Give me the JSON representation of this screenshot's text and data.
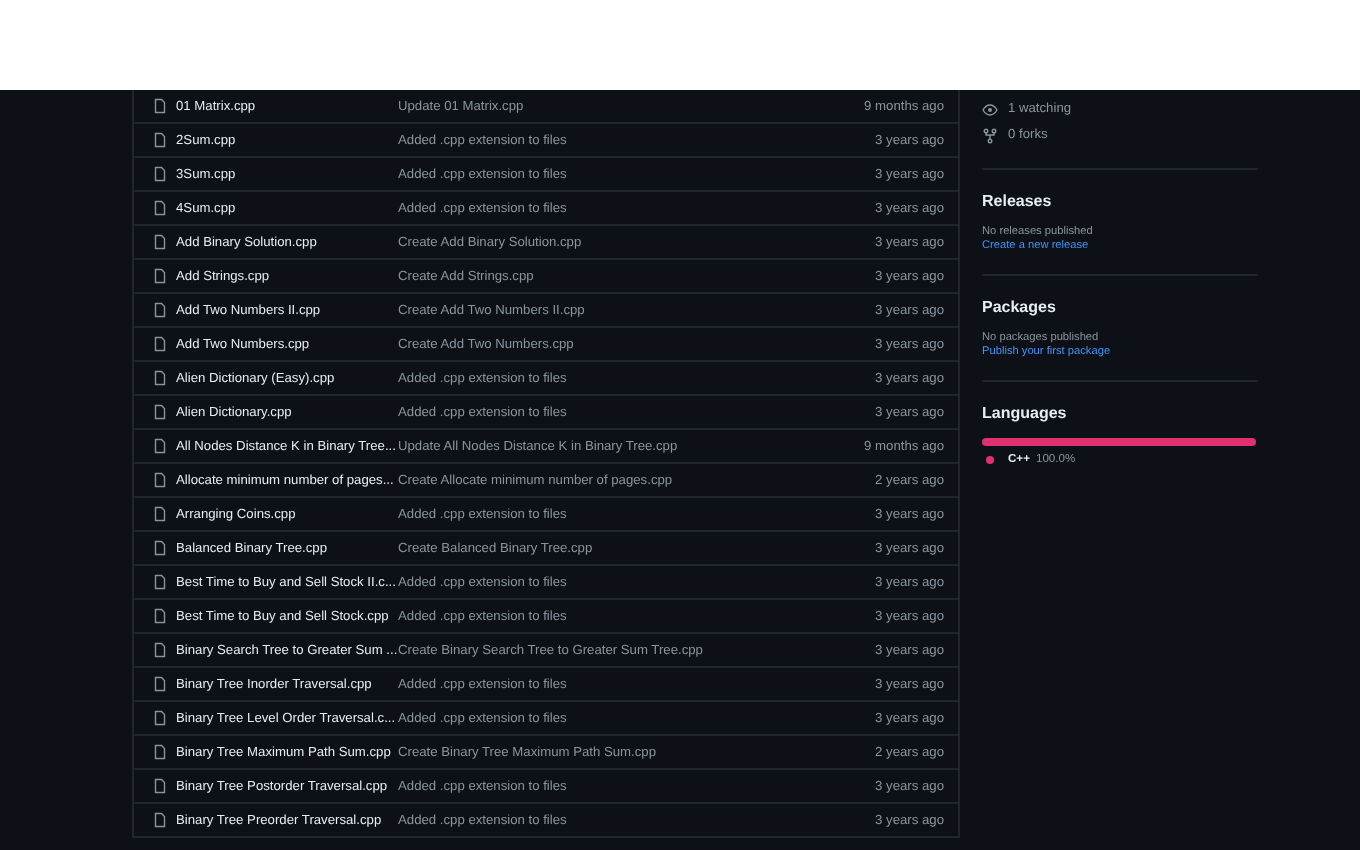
{
  "files": [
    {
      "name": "01 Matrix.cpp",
      "message": "Update 01 Matrix.cpp",
      "age": "9 months ago"
    },
    {
      "name": "2Sum.cpp",
      "message": "Added .cpp extension to files",
      "age": "3 years ago"
    },
    {
      "name": "3Sum.cpp",
      "message": "Added .cpp extension to files",
      "age": "3 years ago"
    },
    {
      "name": "4Sum.cpp",
      "message": "Added .cpp extension to files",
      "age": "3 years ago"
    },
    {
      "name": "Add Binary Solution.cpp",
      "message": "Create Add Binary Solution.cpp",
      "age": "3 years ago"
    },
    {
      "name": "Add Strings.cpp",
      "message": "Create Add Strings.cpp",
      "age": "3 years ago"
    },
    {
      "name": "Add Two Numbers II.cpp",
      "message": "Create Add Two Numbers II.cpp",
      "age": "3 years ago"
    },
    {
      "name": "Add Two Numbers.cpp",
      "message": "Create Add Two Numbers.cpp",
      "age": "3 years ago"
    },
    {
      "name": "Alien Dictionary (Easy).cpp",
      "message": "Added .cpp extension to files",
      "age": "3 years ago"
    },
    {
      "name": "Alien Dictionary.cpp",
      "message": "Added .cpp extension to files",
      "age": "3 years ago"
    },
    {
      "name": "All Nodes Distance K in Binary Tree...",
      "message": "Update All Nodes Distance K in Binary Tree.cpp",
      "age": "9 months ago"
    },
    {
      "name": "Allocate minimum number of pages...",
      "message": "Create Allocate minimum number of pages.cpp",
      "age": "2 years ago"
    },
    {
      "name": "Arranging Coins.cpp",
      "message": "Added .cpp extension to files",
      "age": "3 years ago"
    },
    {
      "name": "Balanced Binary Tree.cpp",
      "message": "Create Balanced Binary Tree.cpp",
      "age": "3 years ago"
    },
    {
      "name": "Best Time to Buy and Sell Stock II.c...",
      "message": "Added .cpp extension to files",
      "age": "3 years ago"
    },
    {
      "name": "Best Time to Buy and Sell Stock.cpp",
      "message": "Added .cpp extension to files",
      "age": "3 years ago"
    },
    {
      "name": "Binary Search Tree to Greater Sum ...",
      "message": "Create Binary Search Tree to Greater Sum Tree.cpp",
      "age": "3 years ago"
    },
    {
      "name": "Binary Tree Inorder Traversal.cpp",
      "message": "Added .cpp extension to files",
      "age": "3 years ago"
    },
    {
      "name": "Binary Tree Level Order Traversal.c...",
      "message": "Added .cpp extension to files",
      "age": "3 years ago"
    },
    {
      "name": "Binary Tree Maximum Path Sum.cpp",
      "message": "Create Binary Tree Maximum Path Sum.cpp",
      "age": "2 years ago"
    },
    {
      "name": "Binary Tree Postorder Traversal.cpp",
      "message": "Added .cpp extension to files",
      "age": "3 years ago"
    },
    {
      "name": "Binary Tree Preorder Traversal.cpp",
      "message": "Added .cpp extension to files",
      "age": "3 years ago"
    }
  ],
  "sidebar": {
    "stats": [
      {
        "kind": "watching",
        "label": "1 watching"
      },
      {
        "kind": "forks",
        "label": "0 forks"
      }
    ],
    "sections": [
      {
        "title": "Releases",
        "note": "No releases published",
        "link": "Create a new release"
      },
      {
        "title": "Packages",
        "note": "No packages published",
        "link": "Publish your first package"
      }
    ],
    "languages": {
      "title": "Languages",
      "items": [
        {
          "name": "C++",
          "percent": "100.0%",
          "color": "#e0306f",
          "level": 1
        }
      ]
    }
  }
}
